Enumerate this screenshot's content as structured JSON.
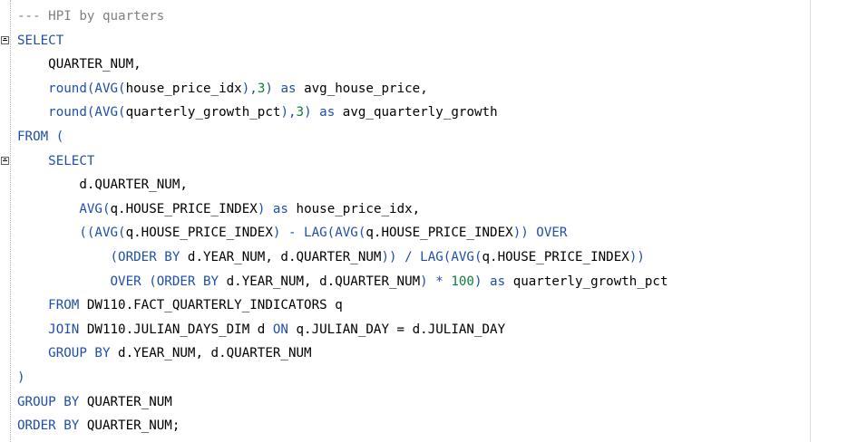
{
  "editor": {
    "lines": [
      {
        "indent": "",
        "segments": [
          {
            "t": "--- HPI by quarters",
            "k": "cm"
          }
        ]
      },
      {
        "indent": "",
        "fold": true,
        "segments": [
          {
            "t": "SELECT",
            "k": "kw"
          }
        ]
      },
      {
        "indent": "    ",
        "segments": [
          {
            "t": "QUARTER_NUM,",
            "k": "id"
          }
        ]
      },
      {
        "indent": "    ",
        "segments": [
          {
            "t": "round(AVG(",
            "k": "kw"
          },
          {
            "t": "house_price_idx",
            "k": "id"
          },
          {
            "t": "),",
            "k": "kw"
          },
          {
            "t": "3",
            "k": "num"
          },
          {
            "t": ") as ",
            "k": "kw"
          },
          {
            "t": "avg_house_price,",
            "k": "id"
          }
        ]
      },
      {
        "indent": "    ",
        "segments": [
          {
            "t": "round(AVG(",
            "k": "kw"
          },
          {
            "t": "quarterly_growth_pct",
            "k": "id"
          },
          {
            "t": "),",
            "k": "kw"
          },
          {
            "t": "3",
            "k": "num"
          },
          {
            "t": ") as ",
            "k": "kw"
          },
          {
            "t": "avg_quarterly_growth",
            "k": "id"
          }
        ]
      },
      {
        "indent": "",
        "segments": [
          {
            "t": "FROM (",
            "k": "kw"
          }
        ]
      },
      {
        "indent": "    ",
        "fold": true,
        "segments": [
          {
            "t": "SELECT",
            "k": "kw"
          }
        ]
      },
      {
        "indent": "        ",
        "segments": [
          {
            "t": "d.QUARTER_NUM,",
            "k": "id"
          }
        ]
      },
      {
        "indent": "        ",
        "segments": [
          {
            "t": "AVG(",
            "k": "kw"
          },
          {
            "t": "q.HOUSE_PRICE_INDEX",
            "k": "id"
          },
          {
            "t": ") as ",
            "k": "kw"
          },
          {
            "t": "house_price_idx,",
            "k": "id"
          }
        ]
      },
      {
        "indent": "        ",
        "segments": [
          {
            "t": "((AVG(",
            "k": "kw"
          },
          {
            "t": "q.HOUSE_PRICE_INDEX",
            "k": "id"
          },
          {
            "t": ") - LAG(AVG(",
            "k": "kw"
          },
          {
            "t": "q.HOUSE_PRICE_INDEX",
            "k": "id"
          },
          {
            "t": ")) OVER",
            "k": "kw"
          }
        ]
      },
      {
        "indent": "            ",
        "segments": [
          {
            "t": "(ORDER BY ",
            "k": "kw"
          },
          {
            "t": "d.YEAR_NUM, d.QUARTER_NUM",
            "k": "id"
          },
          {
            "t": ")) / LAG(AVG(",
            "k": "kw"
          },
          {
            "t": "q.HOUSE_PRICE_INDEX",
            "k": "id"
          },
          {
            "t": "))",
            "k": "kw"
          }
        ]
      },
      {
        "indent": "            ",
        "segments": [
          {
            "t": "OVER (ORDER BY ",
            "k": "kw"
          },
          {
            "t": "d.YEAR_NUM, d.QUARTER_NUM",
            "k": "id"
          },
          {
            "t": ") * ",
            "k": "kw"
          },
          {
            "t": "100",
            "k": "num"
          },
          {
            "t": ") as ",
            "k": "kw"
          },
          {
            "t": "quarterly_growth_pct",
            "k": "id"
          }
        ]
      },
      {
        "indent": "    ",
        "segments": [
          {
            "t": "FROM ",
            "k": "kw"
          },
          {
            "t": "DW110.FACT_QUARTERLY_INDICATORS q",
            "k": "id"
          }
        ]
      },
      {
        "indent": "    ",
        "segments": [
          {
            "t": "JOIN ",
            "k": "kw"
          },
          {
            "t": "DW110.JULIAN_DAYS_DIM d ",
            "k": "id"
          },
          {
            "t": "ON ",
            "k": "kw"
          },
          {
            "t": "q.JULIAN_DAY = d.JULIAN_DAY",
            "k": "id"
          }
        ]
      },
      {
        "indent": "    ",
        "segments": [
          {
            "t": "GROUP BY ",
            "k": "kw"
          },
          {
            "t": "d.YEAR_NUM, d.QUARTER_NUM",
            "k": "id"
          }
        ]
      },
      {
        "indent": "",
        "segments": [
          {
            "t": ")",
            "k": "kw"
          }
        ]
      },
      {
        "indent": "",
        "segments": [
          {
            "t": "GROUP BY ",
            "k": "kw"
          },
          {
            "t": "QUARTER_NUM",
            "k": "id"
          }
        ]
      },
      {
        "indent": "",
        "segments": [
          {
            "t": "ORDER BY ",
            "k": "kw"
          },
          {
            "t": "QUARTER_NUM;",
            "k": "id"
          }
        ]
      }
    ]
  }
}
